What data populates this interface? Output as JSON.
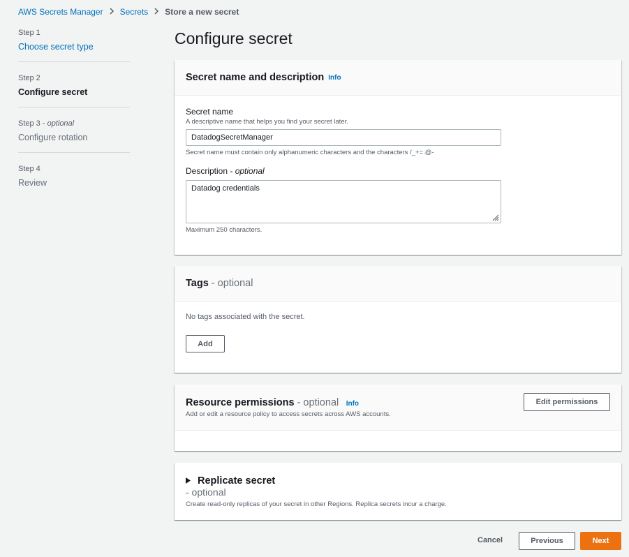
{
  "breadcrumb": {
    "items": [
      "AWS Secrets Manager",
      "Secrets"
    ],
    "current": "Store a new secret"
  },
  "steps": [
    {
      "num": "Step 1",
      "title": "Choose secret type"
    },
    {
      "num": "Step 2",
      "title": "Configure secret"
    },
    {
      "num": "Step 3 - ",
      "num_optional": "optional",
      "title": "Configure rotation"
    },
    {
      "num": "Step 4",
      "title": "Review"
    }
  ],
  "page_title": "Configure secret",
  "secret_panel": {
    "title": "Secret name and description",
    "info": "Info",
    "name_label": "Secret name",
    "name_desc": "A descriptive name that helps you find your secret later.",
    "name_value": "DatadogSecretManager",
    "name_constraint": "Secret name must contain only alphanumeric characters and the characters /_+=.@-",
    "description_label": "Description - ",
    "description_optional": "optional",
    "description_value": "Datadog credentials",
    "description_constraint": "Maximum 250 characters."
  },
  "tags_panel": {
    "title": "Tags",
    "optional": " - optional",
    "empty_text": "No tags associated with the secret.",
    "add_label": "Add"
  },
  "permissions_panel": {
    "title": "Resource permissions",
    "optional": " - optional",
    "info": "Info",
    "description": "Add or edit a resource policy to access secrets across AWS accounts.",
    "edit_label": "Edit permissions"
  },
  "replicate_panel": {
    "title": "Replicate secret",
    "optional": "- optional",
    "description": "Create read-only replicas of your secret in other Regions. Replica secrets incur a charge."
  },
  "footer": {
    "cancel": "Cancel",
    "previous": "Previous",
    "next": "Next"
  },
  "colors": {
    "link": "#0073bb",
    "primary": "#ec7211",
    "background": "#f2f3f3"
  }
}
